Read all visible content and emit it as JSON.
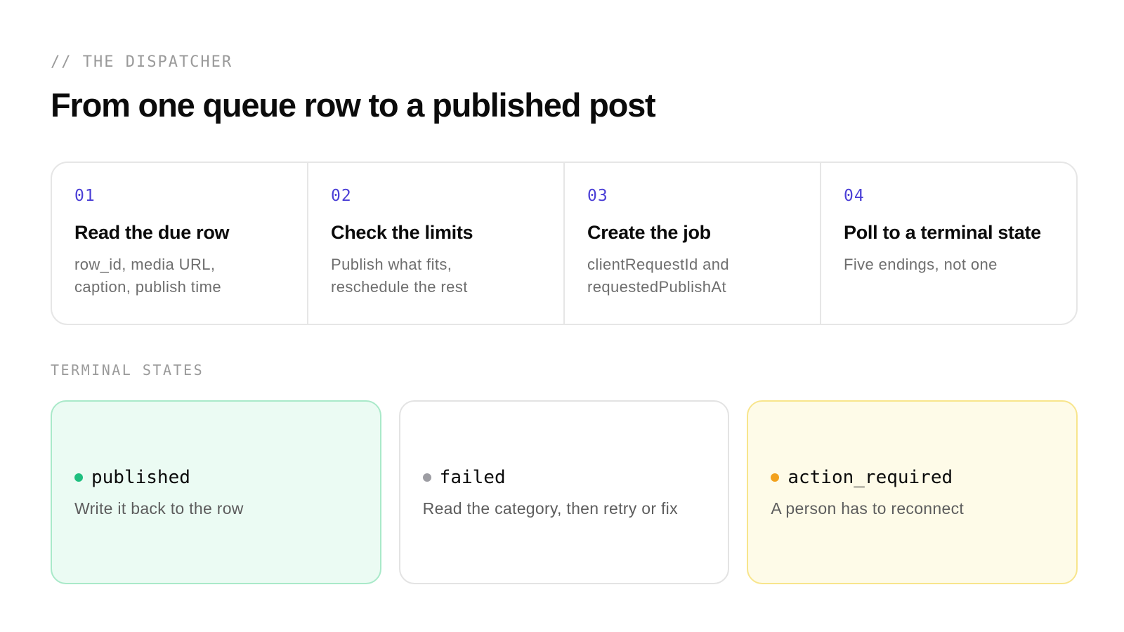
{
  "header": {
    "eyebrow": "// THE DISPATCHER",
    "title": "From one queue row to a published post"
  },
  "steps": [
    {
      "number": "01",
      "title": "Read the due row",
      "desc_lines": [
        "row_id, media URL,",
        "caption, publish time"
      ]
    },
    {
      "number": "02",
      "title": "Check the limits",
      "desc_lines": [
        "Publish what fits,",
        "reschedule the rest"
      ]
    },
    {
      "number": "03",
      "title": "Create the job",
      "desc_lines": [
        "clientRequestId and",
        "requestedPublishAt"
      ]
    },
    {
      "number": "04",
      "title": "Poll to a terminal state",
      "desc_lines": [
        "Five endings, not one"
      ]
    }
  ],
  "terminal_states": {
    "label": "TERMINAL STATES",
    "items": [
      {
        "name": "published",
        "desc": "Write it back to the row",
        "dot_color": "#1fbf7f"
      },
      {
        "name": "failed",
        "desc": "Read the category, then retry or fix",
        "dot_color": "#9d9da3"
      },
      {
        "name": "action_required",
        "desc": "A person has to reconnect",
        "dot_color": "#f2a11d"
      }
    ]
  },
  "colors": {
    "accent_number": "#4b3fd6",
    "published_bg": "#ebfbf3",
    "action_bg": "#fefbe8"
  }
}
